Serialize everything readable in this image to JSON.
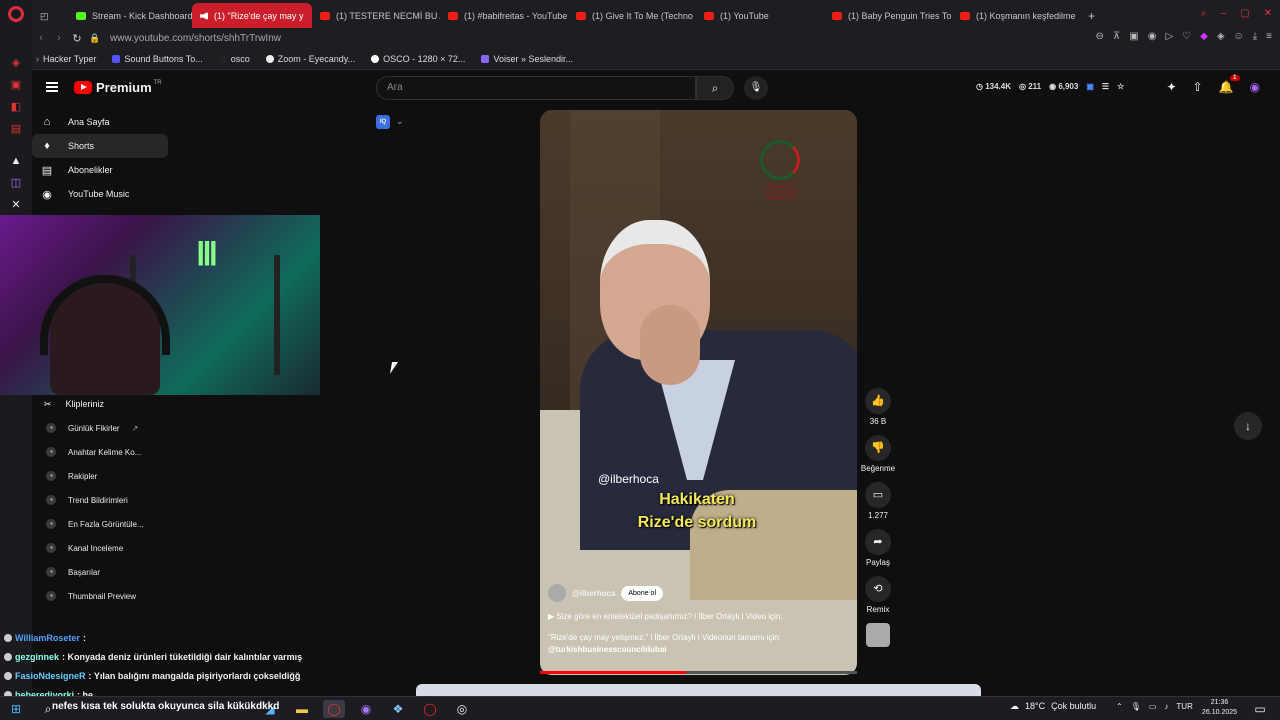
{
  "browser": {
    "tabs": [
      {
        "label": "Stream - Kick Dashboard",
        "type": "kick",
        "active": false
      },
      {
        "label": "(1) \"Rize'de çay may y",
        "type": "speaker",
        "active": true
      },
      {
        "label": "(1) TESTERE NECMİ BU A",
        "type": "yt",
        "active": false
      },
      {
        "label": "(1) #babifreitas - YouTube",
        "type": "yt",
        "active": false
      },
      {
        "label": "(1) Give It To Me (Techno",
        "type": "yt",
        "active": false
      },
      {
        "label": "(1) YouTube",
        "type": "yt",
        "active": false
      },
      {
        "label": "(1) Baby Penguin Tries To",
        "type": "yt",
        "active": false
      },
      {
        "label": "(1) Koşmanın keşfedilme",
        "type": "yt",
        "active": false
      }
    ],
    "new_tab": "+",
    "url": "www.youtube.com/shorts/shhTrTrwInw",
    "bookmarks": [
      "Hacker Typer",
      "Sound Buttons To...",
      "osco",
      "Zoom - Eyecandy...",
      "OSCO - 1280 × 72...",
      "Voiser » Seslendir..."
    ]
  },
  "yt": {
    "logo_text": "Premium",
    "country": "TR",
    "search_placeholder": "Ara",
    "stats": [
      "134.4K",
      "211",
      "6,903"
    ],
    "notif_count": "1",
    "sidebar": [
      {
        "label": "Ana Sayfa",
        "icon": "home-icon",
        "glyph": "⌂"
      },
      {
        "label": "Shorts",
        "icon": "shorts-icon",
        "glyph": "♦"
      },
      {
        "label": "Abonelikler",
        "icon": "subscriptions-icon",
        "glyph": "▤"
      },
      {
        "label": "YouTube Music",
        "icon": "music-icon",
        "glyph": "◉"
      }
    ],
    "clips_label": "Klipleriniz",
    "tools": [
      "Günlük Fikirler",
      "Anahtar Kelime Ko...",
      "Rakipler",
      "Trend Bildirimleri",
      "En Fazla Görüntüle...",
      "Kanal Inceleme",
      "Başarılar",
      "Thumbnail Preview"
    ],
    "filter_label": "IQ"
  },
  "video": {
    "handle_overlay": "@ilberhoca",
    "caption_line1": "Hakikaten",
    "caption_line2": "Rize'de sordum",
    "logo_text": "TURKISH BUSINESS COUNCIL",
    "channel": "@ilberhoca",
    "subscribe": "Abone ol",
    "desc1": "▶ Size göre en entelektüel padişahımız? l İlber Ortaylı l Video için;",
    "desc2": "\"Rize'de çay may yetişmez.\" l İlber Ortaylı l Videonun tamamı için;",
    "desc3": "@turkishbusinesscouncildubai",
    "progress": 0.46
  },
  "actions": {
    "like_count": "36 B",
    "dislike_label": "Beğenme",
    "comment_count": "1.277",
    "share_label": "Paylaş",
    "remix_label": "Remix"
  },
  "chat": [
    {
      "user": "WilliamRoseter",
      "text": ":"
    },
    {
      "user": "gezginnek",
      "text": ": Konyada deniz ürünleri tüketildiği dair kalıntılar varmış"
    },
    {
      "user": "FasioNdesigneR",
      "text": ": Yılan balığını mangalda pişiriyorlardı çokseldiğğ"
    },
    {
      "user": "beberediyorki",
      "text": ": he"
    }
  ],
  "taskbar": {
    "ticker": "nefes kısa tek solukta okuyunca sila kükükdkkd",
    "temp": "18°C",
    "weather": "Çok bulutlu",
    "lang": "TUR",
    "time": "21:36",
    "date": "26.10.2025"
  }
}
